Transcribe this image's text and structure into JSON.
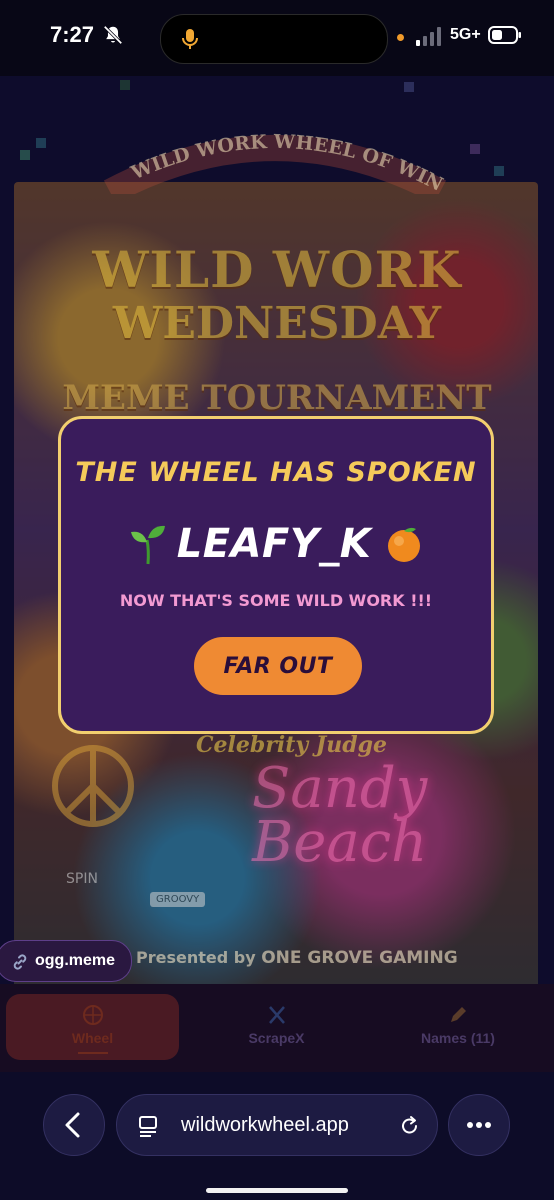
{
  "status_bar": {
    "time": "7:27",
    "network": "5G+"
  },
  "poster": {
    "arc_title": "WILD WORK WHEEL OF WINNERS",
    "title_line1": "WILD WORK",
    "title_line2": "WEDNESDAY",
    "title_line3": "MEME TOURNAMENT",
    "celebrity_label": "Celebrity Judge",
    "judge_name_line1": "Sandy",
    "judge_name_line2": "Beach",
    "spin_label": "SPIN",
    "plate_label": "GROOVY",
    "presented_prefix": "Presented by",
    "presented_by": "ONE GROVE GAMING"
  },
  "modal": {
    "title": "THE WHEEL HAS SPOKEN",
    "winner_name": "LEAFY_K",
    "winner_prefix_icon": "seedling-icon",
    "winner_suffix_icon": "tangerine-icon",
    "subtitle": "NOW THAT'S SOME WILD WORK !!!",
    "button_label": "FAR OUT"
  },
  "link_chip": {
    "icon": "link-icon",
    "label": "ogg.meme"
  },
  "tabs": [
    {
      "label": "Wheel",
      "icon": "wheel-icon",
      "active": true
    },
    {
      "label": "ScrapeX",
      "icon": "x-logo-icon",
      "active": false
    },
    {
      "label": "Names (11)",
      "icon": "pencil-icon",
      "active": false
    }
  ],
  "browser": {
    "url": "wildworkwheel.app"
  },
  "colors": {
    "modal_bg": "#3a1c5c",
    "modal_border": "#f2cf6f",
    "title_gold": "#f5ca5a",
    "subtitle_pink": "#f39ad2",
    "button_orange": "#ef8a33"
  }
}
